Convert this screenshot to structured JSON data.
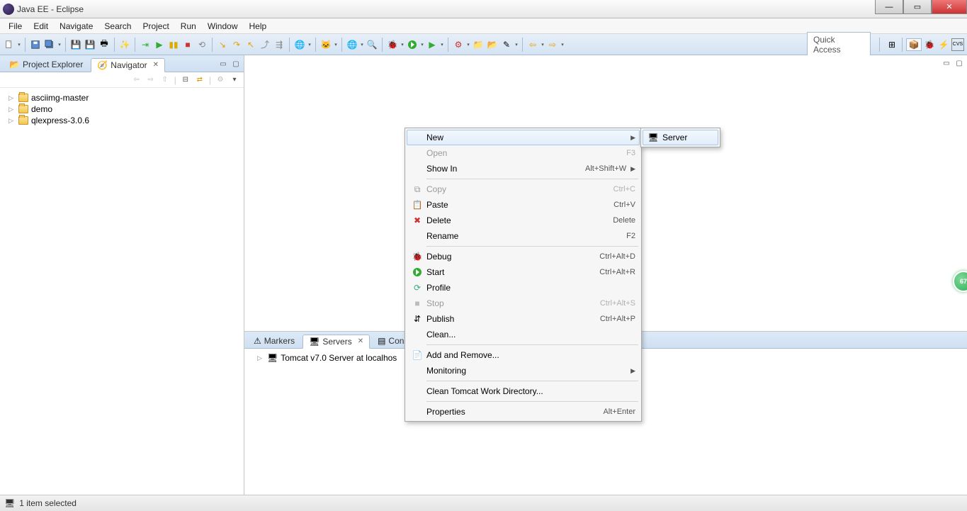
{
  "window": {
    "title": "Java EE - Eclipse"
  },
  "menubar": [
    "File",
    "Edit",
    "Navigate",
    "Search",
    "Project",
    "Run",
    "Window",
    "Help"
  ],
  "quick_access": "Quick Access",
  "left_view": {
    "tabs": [
      {
        "label": "Project Explorer",
        "active": false
      },
      {
        "label": "Navigator",
        "active": true
      }
    ],
    "projects": [
      "asciimg-master",
      "demo",
      "qlexpress-3.0.6"
    ]
  },
  "bottom_view": {
    "tabs": [
      {
        "label": "Markers",
        "active": false
      },
      {
        "label": "Servers",
        "active": true
      },
      {
        "label": "Cons",
        "active": false
      }
    ],
    "server": "Tomcat v7.0 Server at localhos"
  },
  "context_menu": [
    {
      "label": "New",
      "submenu": true,
      "highlight": true
    },
    {
      "label": "Open",
      "shortcut": "F3",
      "disabled": true
    },
    {
      "label": "Show In",
      "shortcut": "Alt+Shift+W",
      "submenu": true
    },
    {
      "sep": true
    },
    {
      "label": "Copy",
      "shortcut": "Ctrl+C",
      "disabled": true,
      "icon": "copy"
    },
    {
      "label": "Paste",
      "shortcut": "Ctrl+V",
      "icon": "paste"
    },
    {
      "label": "Delete",
      "shortcut": "Delete",
      "icon": "delete"
    },
    {
      "label": "Rename",
      "shortcut": "F2"
    },
    {
      "sep": true
    },
    {
      "label": "Debug",
      "shortcut": "Ctrl+Alt+D",
      "icon": "debug"
    },
    {
      "label": "Start",
      "shortcut": "Ctrl+Alt+R",
      "icon": "start"
    },
    {
      "label": "Profile",
      "icon": "profile"
    },
    {
      "label": "Stop",
      "shortcut": "Ctrl+Alt+S",
      "disabled": true,
      "icon": "stop"
    },
    {
      "label": "Publish",
      "shortcut": "Ctrl+Alt+P",
      "icon": "publish"
    },
    {
      "label": "Clean..."
    },
    {
      "sep": true
    },
    {
      "label": "Add and Remove...",
      "icon": "addremove"
    },
    {
      "label": "Monitoring",
      "submenu": true
    },
    {
      "sep": true
    },
    {
      "label": "Clean Tomcat Work Directory..."
    },
    {
      "sep": true
    },
    {
      "label": "Properties",
      "shortcut": "Alt+Enter"
    }
  ],
  "submenu": [
    {
      "label": "Server",
      "highlight": true,
      "icon": "server"
    }
  ],
  "statusbar": {
    "text": "1 item selected"
  },
  "float_badge": "67"
}
